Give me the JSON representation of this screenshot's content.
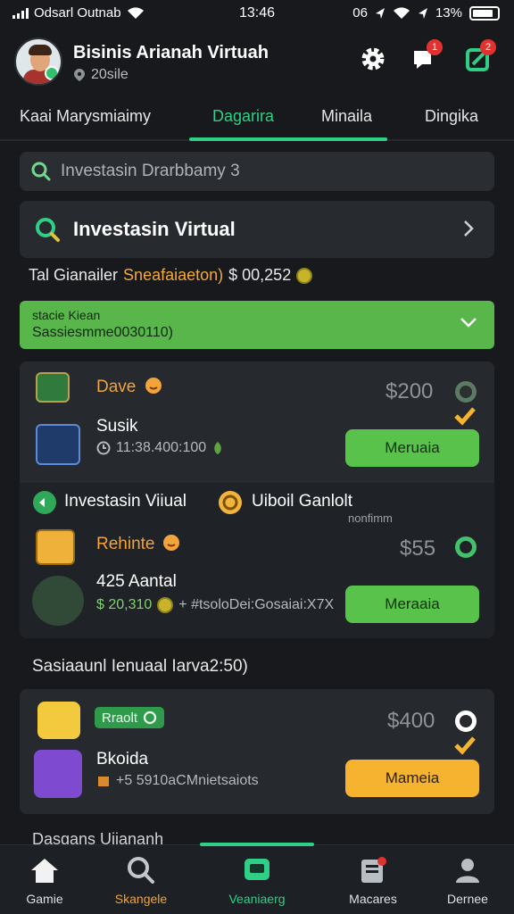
{
  "status": {
    "carrier": "Odsarl Outnab",
    "time": "13:46",
    "right_text": "06",
    "battery": "13%"
  },
  "header": {
    "title": "Bisinis Arianah Virtuah",
    "subtitle": "20sile",
    "notif_badge": "1",
    "share_badge": "2"
  },
  "tabs": [
    {
      "label": "Kaai Marysmiaimy"
    },
    {
      "label": "Dagarira"
    },
    {
      "label": "Minaila"
    },
    {
      "label": "Dingika"
    }
  ],
  "search": {
    "placeholder": "Investasin Drarbbamy 3"
  },
  "featured": {
    "label": "Investasin Virtual"
  },
  "total": {
    "prefix": "Tal Gianailer",
    "highlight": "Sneafaiaeton)",
    "amount": "$ 00,252"
  },
  "banner": {
    "line1": "stacie Kiean",
    "line2": "Sassiesmme0030110)"
  },
  "listings": [
    {
      "title": "Dave",
      "name": "Susik",
      "meta": "11:38.400:100",
      "price": "$200",
      "button": "Meruaia"
    },
    {
      "title": "Rehinte",
      "name": "425 Aantal",
      "meta_amount": "$ 20,310",
      "meta": "+ #tsoloDei:Gosaiai:X7X",
      "price": "$55",
      "button": "Meraaia"
    }
  ],
  "subsection": {
    "left": "Investasin Viiual",
    "right": "Uiboil Ganlolt",
    "note": "nonfimm"
  },
  "section_label": "Sasiaaunl Ienuaal Iarva2:50)",
  "promo": {
    "tag": "Rraolt",
    "name": "Bkoida",
    "meta": "+5 5910aCMnietsaiots",
    "price": "$400",
    "button": "Mameia"
  },
  "partial_text": "Dasgans Uiiananh",
  "nav": [
    {
      "label": "Gamie"
    },
    {
      "label": "Skangele"
    },
    {
      "label": "Veaniaerg"
    },
    {
      "label": "Macares"
    },
    {
      "label": "Dernee"
    }
  ],
  "colors": {
    "accent": "#2fcf86",
    "green_button": "#58c24a",
    "yellow_button": "#f6b32f",
    "orange_text": "#f2a33a",
    "background": "#17191c"
  }
}
